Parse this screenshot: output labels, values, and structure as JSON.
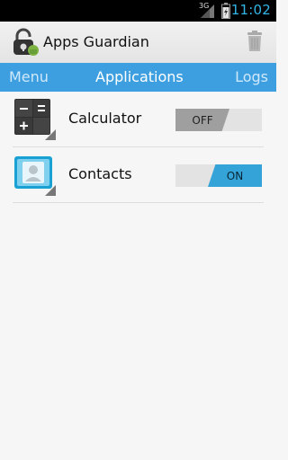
{
  "status_bar": {
    "network": "3G",
    "time": "11:02",
    "time_color": "#33b5e5"
  },
  "header": {
    "title": "Apps Guardian",
    "logo_icon": "lock-android-icon",
    "action_icon": "trash-icon"
  },
  "tabs": [
    {
      "label": "Menu",
      "selected": false
    },
    {
      "label": "Applications",
      "selected": true
    },
    {
      "label": "Logs",
      "selected": false
    }
  ],
  "apps": [
    {
      "name": "Calculator",
      "icon": "calculator-icon",
      "toggle_label": "OFF",
      "enabled": false
    },
    {
      "name": "Contacts",
      "icon": "contacts-icon",
      "toggle_label": "ON",
      "enabled": true
    }
  ],
  "colors": {
    "accent": "#3d9fe0",
    "toggle_on": "#34a3d8",
    "toggle_off": "#9f9f9f"
  }
}
